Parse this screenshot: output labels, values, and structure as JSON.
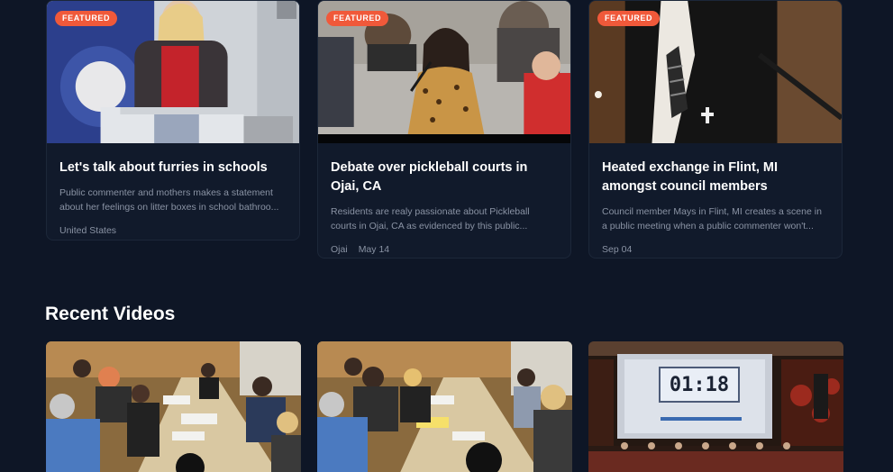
{
  "featured": [
    {
      "badge": "FEATURED",
      "title": "Let's talk about furries in schools",
      "description": "Public commenter and mothers makes a statement about her feelings on litter boxes in school bathroo...",
      "meta": [
        "United States"
      ]
    },
    {
      "badge": "FEATURED",
      "title": "Debate over pickleball courts in Ojai, CA",
      "description": "Residents are realy passionate about Pickleball courts in Ojai, CA as evidenced by this public...",
      "meta": [
        "Ojai",
        "May 14"
      ]
    },
    {
      "badge": "FEATURED",
      "title": "Heated exchange in Flint, MI amongst council members",
      "description": "Council member Mays in Flint, MI creates a scene in a public meeting when a public commenter won't...",
      "meta": [
        "Sep 04"
      ]
    }
  ],
  "recent": {
    "heading": "Recent Videos",
    "timer_text": "01:18"
  },
  "colors": {
    "background": "#0e1626",
    "card": "#111a2b",
    "badge": "#f0593a",
    "muted_text": "#8a93a4"
  }
}
